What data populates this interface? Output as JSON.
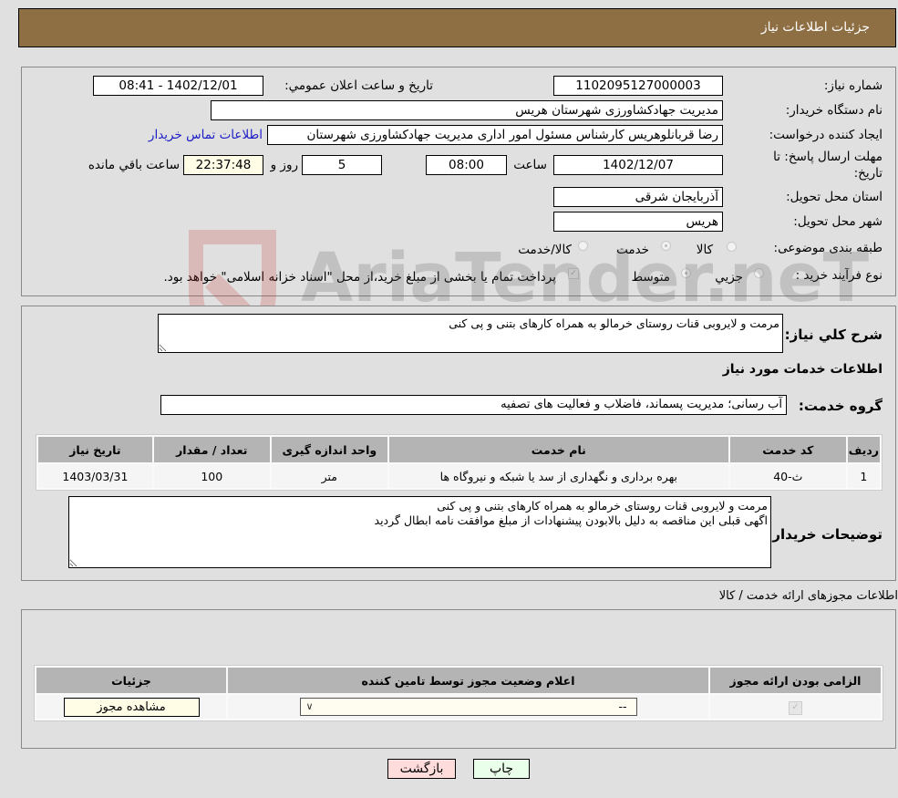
{
  "header": {
    "title": "جزئیات اطلاعات نیاز"
  },
  "form": {
    "need_number_label": "شماره نیاز:",
    "need_number": "1102095127000003",
    "announce_label": "تاریخ و ساعت اعلان عمومي:",
    "announce_value": "1402/12/01 - 08:41",
    "buyer_org_label": "نام دستگاه خریدار:",
    "buyer_org": "مدیریت جهادکشاورزی شهرستان هریس",
    "creator_label": "ایجاد کننده درخواست:",
    "creator": "رضا قربانلوهریس کارشناس مسئول امور اداری مدیریت جهادکشاورزی شهرستان",
    "contact_link": "اطلاعات تماس خریدار",
    "deadline_label": "مهلت ارسال پاسخ: تا تاریخ:",
    "deadline_date": "1402/12/07",
    "time_label": "ساعت",
    "deadline_time": "08:00",
    "days_value": "5",
    "days_label": "روز و",
    "remaining_time": "22:37:48",
    "remaining_label": "ساعت باقي مانده",
    "province_label": "استان محل تحویل:",
    "province": "آذربایجان شرقی",
    "city_label": "شهر محل تحویل:",
    "city": "هریس",
    "category_label": "طبقه بندی موضوعی:",
    "category_options": [
      "کالا",
      "خدمت",
      "کالا/خدمت"
    ],
    "category_selected": "خدمت",
    "process_label": "نوع فرآیند خرید :",
    "process_options": [
      "جزيي",
      "متوسط"
    ],
    "process_selected": "متوسط",
    "treasury_note": "پرداخت تمام یا بخشی از مبلغ خرید،از محل \"اسناد خزانه اسلامی\" خواهد بود."
  },
  "details": {
    "summary_label": "شرح کلي نیاز:",
    "summary": "مرمت و لایروبی قنات روستای خرمالو به همراه کارهای بتنی و پی کنی",
    "services_heading": "اطلاعات خدمات مورد نیاز",
    "service_group_label": "گروه خدمت:",
    "service_group": "آب رسانی؛ مدیریت پسماند، فاضلاب و فعالیت های تصفیه",
    "table": {
      "headers": [
        "ردیف",
        "کد خدمت",
        "نام خدمت",
        "واحد اندازه گیری",
        "تعداد / مقدار",
        "تاریخ نیاز"
      ],
      "rows": [
        [
          "1",
          "ث-40",
          "بهره برداری و نگهداری از سد یا شبکه و نیروگاه ها",
          "متر",
          "100",
          "1403/03/31"
        ]
      ]
    },
    "buyer_notes_label": "توضیحات خریدار:",
    "buyer_notes": "مرمت و لایروبی قنات روستای خرمالو به همراه کارهای بتنی و پی کنی\nاگهی قبلی این مناقصه به دلیل بالابودن پیشنهادات از مبلغ موافقت نامه ابطال گردید"
  },
  "permits": {
    "section_title": "اطلاعات مجوزهای ارائه خدمت / کالا",
    "headers": [
      "الزامی بودن ارائه مجوز",
      "اعلام وضعیت مجوز توسط تامین کننده",
      "جزئیات"
    ],
    "select_value": "--",
    "view_button": "مشاهده مجوز"
  },
  "actions": {
    "print": "چاپ",
    "back": "بازگشت"
  },
  "watermark": {
    "text": "AriaTender.neT"
  }
}
